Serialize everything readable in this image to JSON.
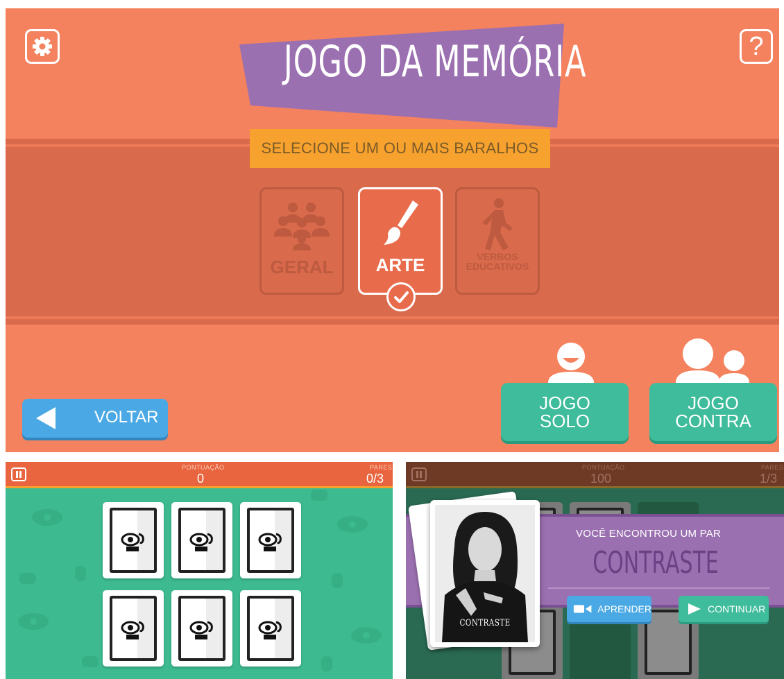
{
  "menu": {
    "title": "JOGO DA MEMÓRIA",
    "subtitle": "SELECIONE UM OU MAIS BARALHOS",
    "settings_icon": "gear-icon",
    "help_icon": "help-icon",
    "help_glyph": "?",
    "decks": [
      {
        "label": "GERAL",
        "icon": "people-icon",
        "selected": false
      },
      {
        "label": "ARTE",
        "icon": "paintbrush-icon",
        "selected": true
      },
      {
        "label_line1": "VERBOS",
        "label_line2": "EDUCATIVOS",
        "icon": "walking-person-icon",
        "selected": false
      }
    ],
    "back_label": "VOLTAR",
    "solo": {
      "line1": "JOGO",
      "line2": "SOLO"
    },
    "versus": {
      "line1": "JOGO",
      "line2": "CONTRA"
    }
  },
  "board": {
    "score_label": "PONTUAÇÃO",
    "score": "0",
    "pairs_label": "PARES",
    "pairs": "0/3"
  },
  "match": {
    "score_label": "PONTUAÇÃO",
    "score": "100",
    "pairs_label": "PARES",
    "pairs": "1/3",
    "found_text": "VOCÊ ENCONTROU UM PAR",
    "word": "CONTRASTE",
    "card_label": "CONTRASTE",
    "learn_label": "APRENDER",
    "continue_label": "CONTINUAR"
  },
  "colors": {
    "menu_bg": "#f4825f",
    "band": "#d96a4c",
    "title_banner": "#9b70b0",
    "subtitle_bg": "#f7a22f",
    "blue_button": "#4aa9e4",
    "green_button": "#3ebc9b",
    "board_bg": "#3dba8f",
    "hud_bg": "#e8653f"
  }
}
